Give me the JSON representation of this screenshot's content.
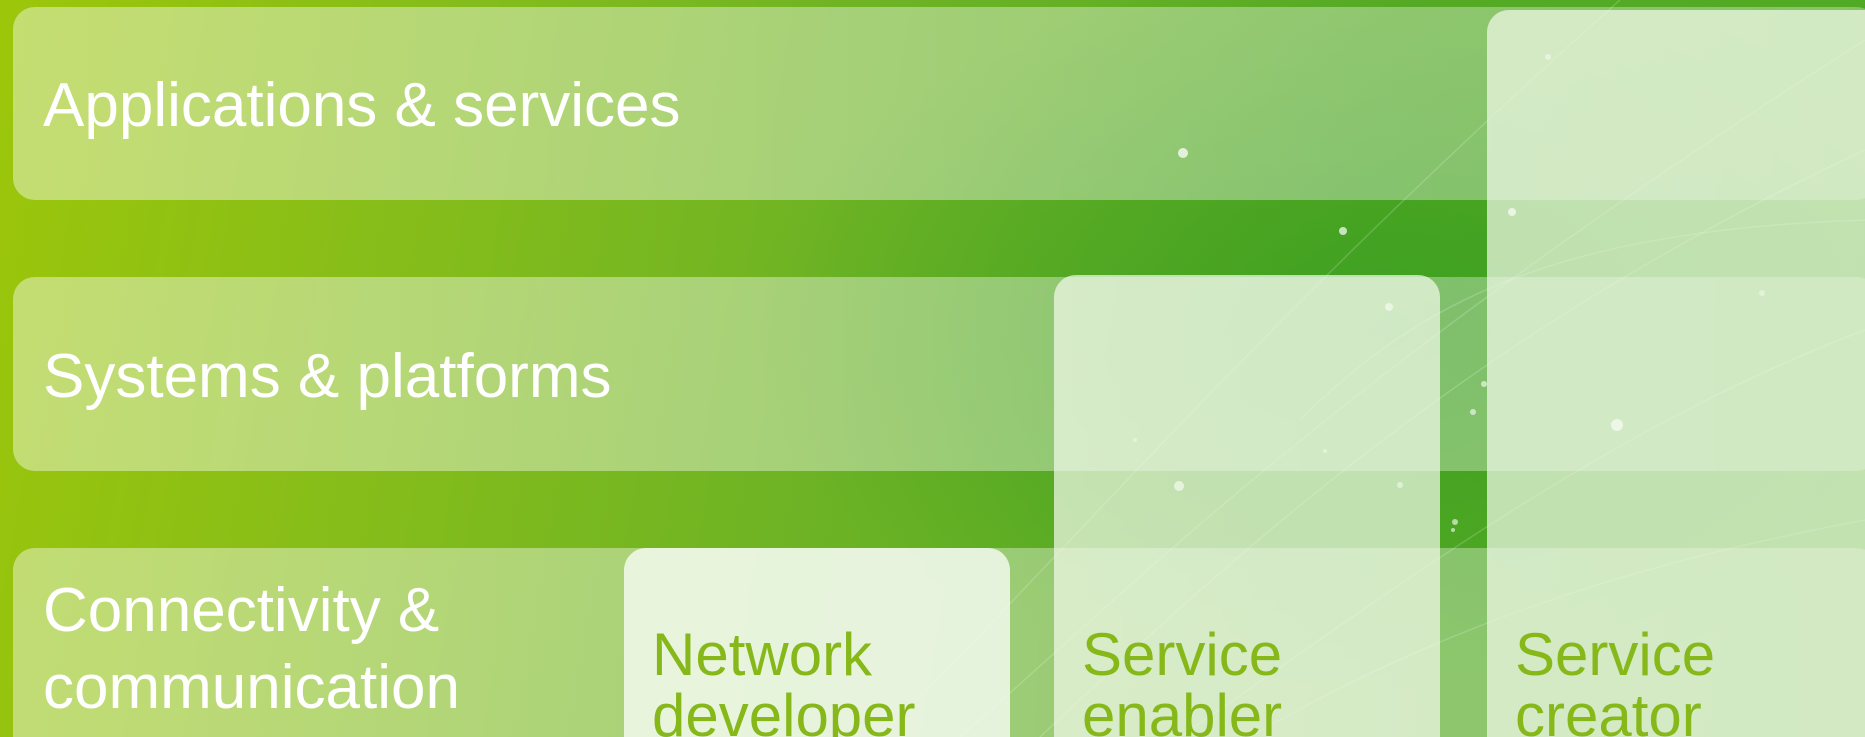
{
  "layers": [
    {
      "id": "apps",
      "label": "Applications & services"
    },
    {
      "id": "systems",
      "label": "Systems & platforms"
    },
    {
      "id": "conn",
      "label_lines": [
        "Connectivity &",
        "communication"
      ]
    }
  ],
  "roles": [
    {
      "id": "network",
      "label_lines": [
        "Network",
        "developer"
      ]
    },
    {
      "id": "enabler",
      "label_lines": [
        "Service",
        "enabler"
      ]
    },
    {
      "id": "creator",
      "label_lines": [
        "Service",
        "creator"
      ]
    }
  ],
  "colors": {
    "background_left": "#9cc60a",
    "background_right": "#4ea922",
    "layer_text": "#ffffff",
    "role_text": "#87b81a"
  }
}
